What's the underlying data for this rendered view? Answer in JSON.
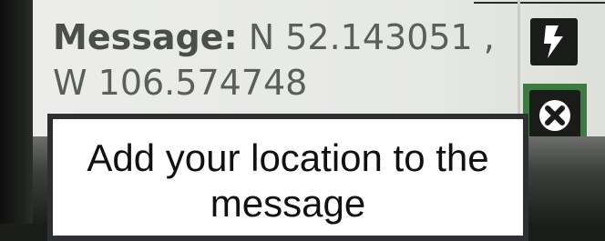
{
  "message": {
    "label": "Message:",
    "value": "N 52.143051 , W 106.574748"
  },
  "buttons": {
    "flash_icon": "lightning-icon",
    "close_icon": "close-icon"
  },
  "caption": {
    "text": "Add your location to the message"
  },
  "colors": {
    "close_button_highlight": "#3f7a45",
    "caption_border": "#2e2f33"
  }
}
